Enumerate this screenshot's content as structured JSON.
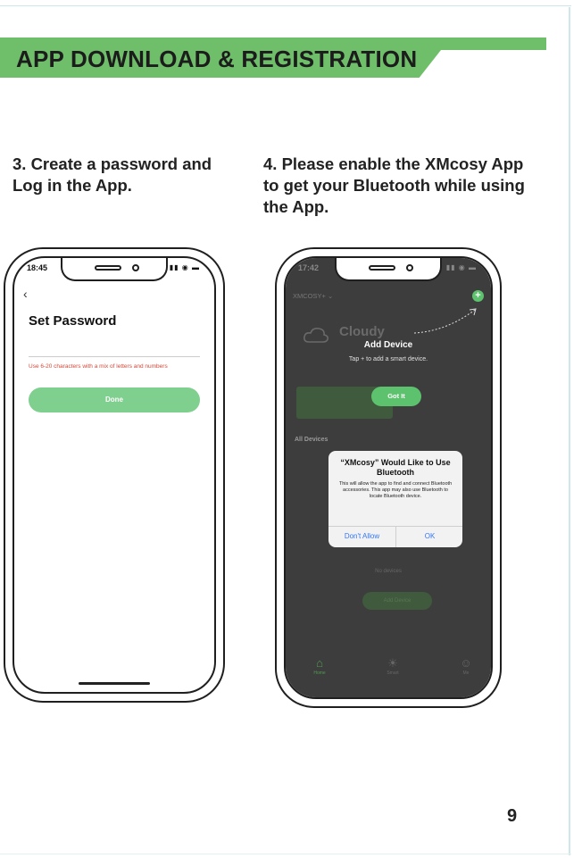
{
  "header": {
    "title": "APP DOWNLOAD & REGISTRATION"
  },
  "steps": [
    {
      "text": "3. Create a password and Log in the App."
    },
    {
      "text": "4. Please enable the XMcosy App to get your Bluetooth while using the App."
    }
  ],
  "left_phone": {
    "time": "18:45",
    "signal": "▮▮ ◉ ▬",
    "back": "‹",
    "title": "Set Password",
    "hint": "Use 6-20 characters with a mix of letters and numbers",
    "done_label": "Done"
  },
  "right_phone": {
    "time": "17:42",
    "signal": "▮▮ ◉ ▬",
    "home_name": "XMCOSY+ ⌄",
    "plus": "+",
    "weather": "Cloudy",
    "add_device_title": "Add Device",
    "tap_hint": "Tap + to add a smart device.",
    "got_it": "Got It",
    "all_devices": "All Devices",
    "dialog": {
      "title": "“XMcosy” Would Like to Use Bluetooth",
      "body": "This will allow the app to find and connect Bluetooth accessories. This app may also use Bluetooth to locate Bluetooth device.",
      "deny": "Don't Allow",
      "ok": "OK"
    },
    "no_devices": "No devices",
    "add_device_btn": "Add Device",
    "tabs": [
      {
        "icon": "⌂",
        "label": "Home"
      },
      {
        "icon": "☀",
        "label": "Smart"
      },
      {
        "icon": "☺",
        "label": "Me"
      }
    ]
  },
  "colors": {
    "accent_green": "#6fbf6a",
    "button_green": "#5dc26d",
    "hint_red": "#d24a3a",
    "ios_blue": "#3478f6"
  },
  "page_number": "9"
}
